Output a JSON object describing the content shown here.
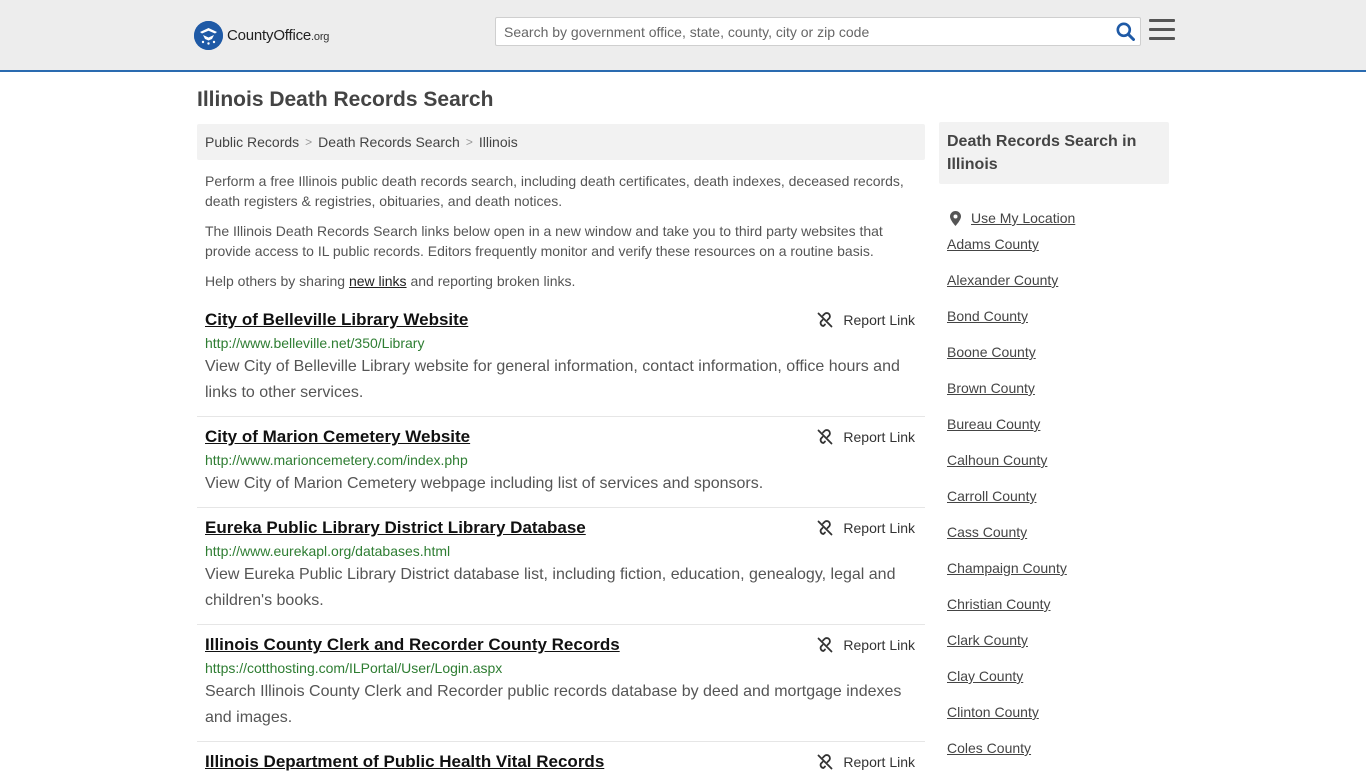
{
  "header": {
    "logo_main": "CountyOffice",
    "logo_suffix": ".org",
    "search_placeholder": "Search by government office, state, county, city or zip code"
  },
  "page": {
    "title": "Illinois Death Records Search"
  },
  "breadcrumb": [
    "Public Records",
    "Death Records Search",
    "Illinois"
  ],
  "intro": {
    "p1": "Perform a free Illinois public death records search, including death certificates, death indexes, deceased records, death registers & registries, obituaries, and death notices.",
    "p2": "The Illinois Death Records Search links below open in a new window and take you to third party websites that provide access to IL public records. Editors frequently monitor and verify these resources on a routine basis.",
    "p3_before": "Help others by sharing ",
    "p3_link": "new links",
    "p3_after": " and reporting broken links."
  },
  "report_label": "Report Link",
  "listings": [
    {
      "title": "City of Belleville Library Website",
      "url": "http://www.belleville.net/350/Library",
      "desc": "View City of Belleville Library website for general information, contact information, office hours and links to other services."
    },
    {
      "title": "City of Marion Cemetery Website",
      "url": "http://www.marioncemetery.com/index.php",
      "desc": "View City of Marion Cemetery webpage including list of services and sponsors."
    },
    {
      "title": "Eureka Public Library District Library Database",
      "url": "http://www.eurekapl.org/databases.html",
      "desc": "View Eureka Public Library District database list, including fiction, education, genealogy, legal and children's books."
    },
    {
      "title": "Illinois County Clerk and Recorder County Records",
      "url": "https://cotthosting.com/ILPortal/User/Login.aspx",
      "desc": "Search Illinois County Clerk and Recorder public records database by deed and mortgage indexes and images."
    },
    {
      "title": "Illinois Department of Public Health Vital Records",
      "url": "",
      "desc": ""
    }
  ],
  "sidebar": {
    "heading": "Death Records Search in Illinois",
    "location_label": "Use My Location",
    "counties": [
      "Adams County",
      "Alexander County",
      "Bond County",
      "Boone County",
      "Brown County",
      "Bureau County",
      "Calhoun County",
      "Carroll County",
      "Cass County",
      "Champaign County",
      "Christian County",
      "Clark County",
      "Clay County",
      "Clinton County",
      "Coles County"
    ]
  },
  "colors": {
    "brand_blue": "#1f5aa6",
    "url_green": "#2e7d32",
    "header_bg": "#ededed"
  }
}
